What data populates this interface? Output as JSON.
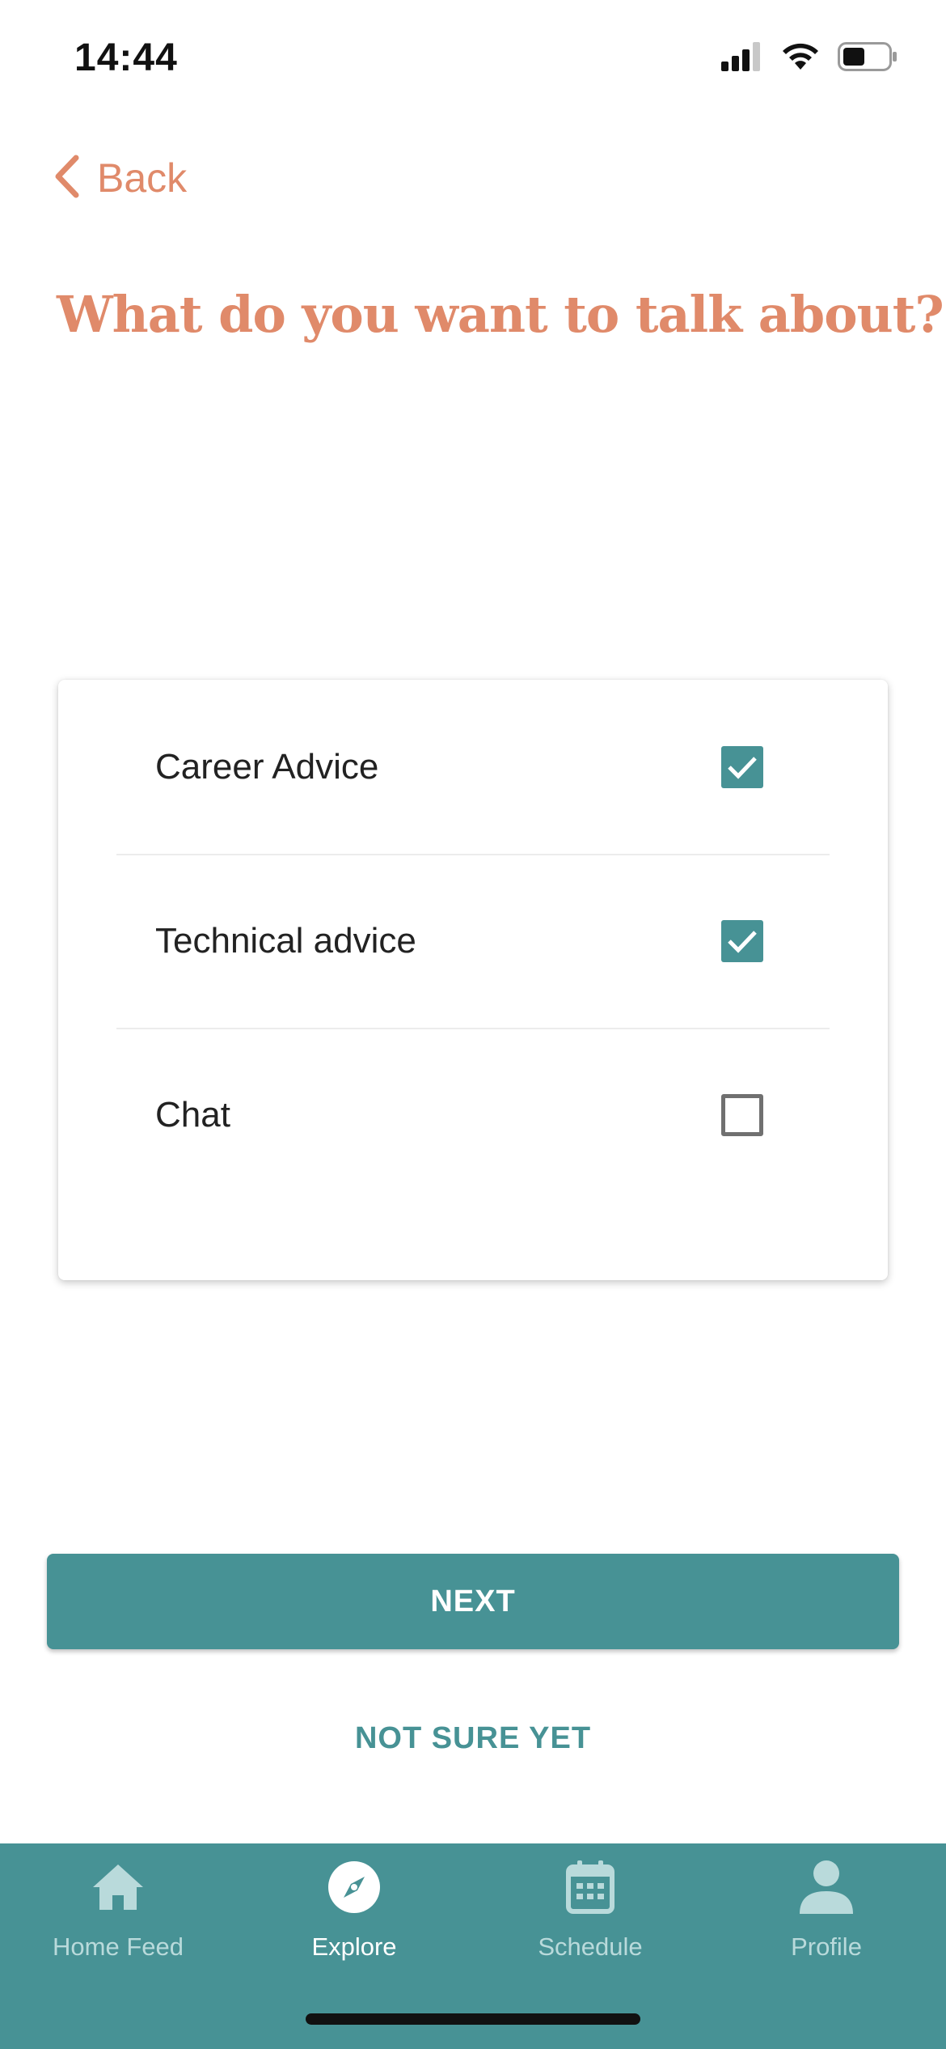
{
  "status_bar": {
    "time": "14:44",
    "icons": [
      "cellular-signal-icon",
      "wifi-icon",
      "battery-icon"
    ]
  },
  "nav": {
    "back_label": "Back",
    "back_icon": "chevron-left-icon"
  },
  "page": {
    "title": "What do you want to talk about?"
  },
  "options": [
    {
      "label": "Career Advice",
      "checked": true
    },
    {
      "label": "Technical advice",
      "checked": true
    },
    {
      "label": "Chat",
      "checked": false
    }
  ],
  "actions": {
    "next_label": "NEXT",
    "not_sure_label": "NOT SURE YET"
  },
  "tab_bar": {
    "tabs": [
      {
        "label": "Home Feed",
        "icon": "home-icon",
        "active": false
      },
      {
        "label": "Explore",
        "icon": "compass-icon",
        "active": true
      },
      {
        "label": "Schedule",
        "icon": "calendar-icon",
        "active": false
      },
      {
        "label": "Profile",
        "icon": "person-icon",
        "active": false
      }
    ]
  },
  "colors": {
    "accent": "#E08A6A",
    "primary": "#479295",
    "tab_inactive": "#B9DADB",
    "text": "#222222"
  }
}
